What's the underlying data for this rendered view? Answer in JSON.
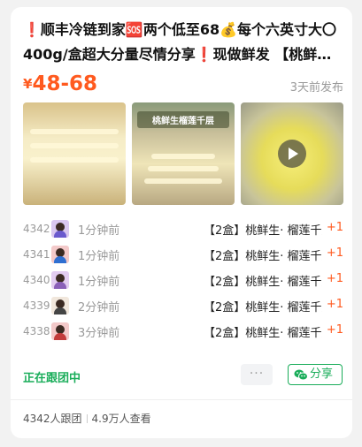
{
  "post": {
    "title": "❗顺丰冷链到家🆘两个低至68💰每个六英寸大〇400g/盒超大分量尽情分享❗现做鲜发 【桃鲜生…",
    "price_currency": "¥",
    "price_range": "48-68",
    "posted": "3天前发布"
  },
  "photos": [
    {
      "name": "durian-cake-photo-1"
    },
    {
      "name": "durian-crepe-cake-photo-2",
      "caption": "桃鲜生榴莲千层"
    },
    {
      "name": "durian-cake-video-3",
      "has_video": true
    }
  ],
  "orders": [
    {
      "num": "4342",
      "ago": "1分钟前",
      "item": "【2盒】桃鲜生· 榴莲千层",
      "qty": "+1",
      "avatar_color": "#d9c7ef",
      "shirt": "#6a5acd"
    },
    {
      "num": "4341",
      "ago": "1分钟前",
      "item": "【2盒】桃鲜生· 榴莲千层",
      "qty": "+1",
      "avatar_color": "#f3c9c9",
      "shirt": "#2f6fd1"
    },
    {
      "num": "4340",
      "ago": "1分钟前",
      "item": "【2盒】桃鲜生· 榴莲千层",
      "qty": "+1",
      "avatar_color": "#e2ccf0",
      "shirt": "#8a5fb8"
    },
    {
      "num": "4339",
      "ago": "2分钟前",
      "item": "【2盒】桃鲜生· 榴莲千层",
      "qty": "+1",
      "avatar_color": "#f1e7dc",
      "shirt": "#444444"
    },
    {
      "num": "4338",
      "ago": "3分钟前",
      "item": "【2盒】桃鲜生· 榴莲千层",
      "qty": "+1",
      "avatar_color": "#f3c9c9",
      "shirt": "#c23b3b"
    }
  ],
  "actions": {
    "status": "正在跟团中",
    "more": "···",
    "share": "分享"
  },
  "footer": {
    "joined": "4342人跟团",
    "views": "4.9万人查看"
  },
  "colors": {
    "accent_price": "#ff5a1f",
    "wechat_green": "#1aad5a"
  }
}
